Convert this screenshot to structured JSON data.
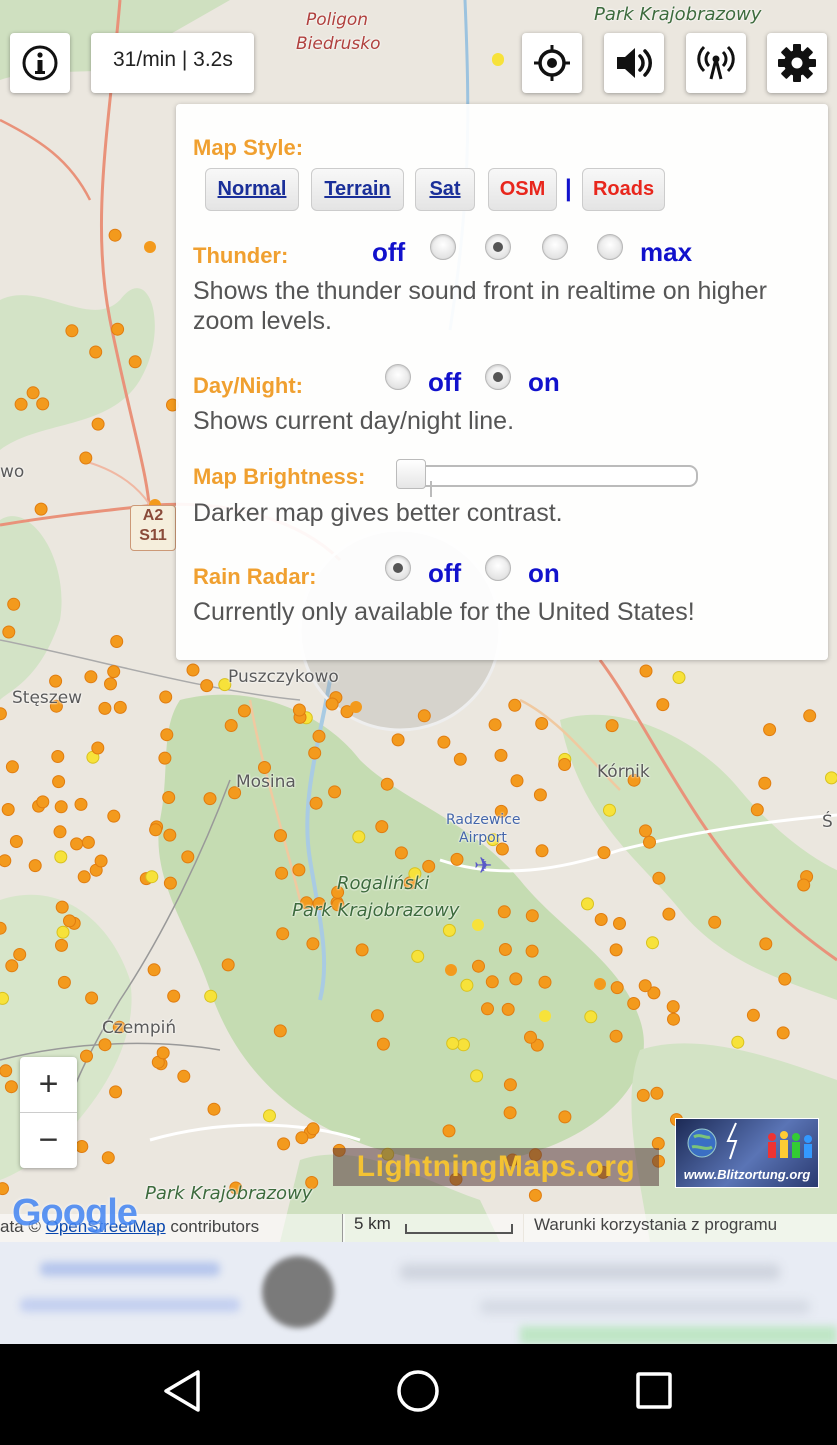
{
  "toolbar": {
    "info_icon": "info-icon",
    "rate_text": "31/min | 3.2s",
    "locate_icon": "crosshair-icon",
    "sound_icon": "speaker-icon",
    "signal_icon": "antenna-icon",
    "settings_icon": "gear-icon"
  },
  "panel": {
    "map_style": {
      "label": "Map Style:",
      "buttons": [
        "Normal",
        "Terrain",
        "Sat",
        "OSM",
        "Roads"
      ],
      "separator": "|"
    },
    "thunder": {
      "label": "Thunder:",
      "min_label": "off",
      "max_label": "max",
      "levels": 4,
      "selected_index": 1,
      "description": "Shows the thunder sound front in realtime on higher zoom levels."
    },
    "day_night": {
      "label": "Day/Night:",
      "off_label": "off",
      "on_label": "on",
      "selected": "on",
      "description": "Shows current day/night line."
    },
    "brightness": {
      "label": "Map Brightness:",
      "value": 0,
      "description": "Darker map gives better contrast."
    },
    "rain_radar": {
      "label": "Rain Radar:",
      "off_label": "off",
      "on_label": "on",
      "selected": "off",
      "description": "Currently only available for the United States!"
    }
  },
  "map": {
    "labels": {
      "poligon": "Poligon",
      "biedrusko": "Biedrusko",
      "park_top": "Park Krajobrazowy",
      "road_a2": "A2",
      "road_s11": "S11",
      "steszew": "Stęszew",
      "puszczykowo": "Puszczykowo",
      "mosina": "Mosina",
      "kornik": "Kórnik",
      "radzewice": "Radzewice",
      "airport": "Airport",
      "rogalinski": "Rogaliński",
      "park_mid": "Park Krajobrazowy",
      "czempin": "Czempiń",
      "park_bottom": "Park Krajobrazowy",
      "s_edge": "Ś",
      "wo_edge": "wo"
    },
    "zoom_in": "+",
    "zoom_out": "−",
    "brand": "LightningMaps.org",
    "blitz_url": "www.Blitzortung.org",
    "google": "Google",
    "attribution_prefix": "ata © ",
    "attribution_link": "OpenStreetMap",
    "attribution_suffix": " contributors",
    "scale_label": "5 km",
    "terms": "Warunki korzystania z programu"
  },
  "colors": {
    "accent_orange": "#f0a030",
    "option_blue": "#1111cc",
    "style_red": "#e8261c",
    "style_link": "#1a2f99",
    "strike_orange": "#f39a1d",
    "strike_yellow": "#f7e23a"
  }
}
